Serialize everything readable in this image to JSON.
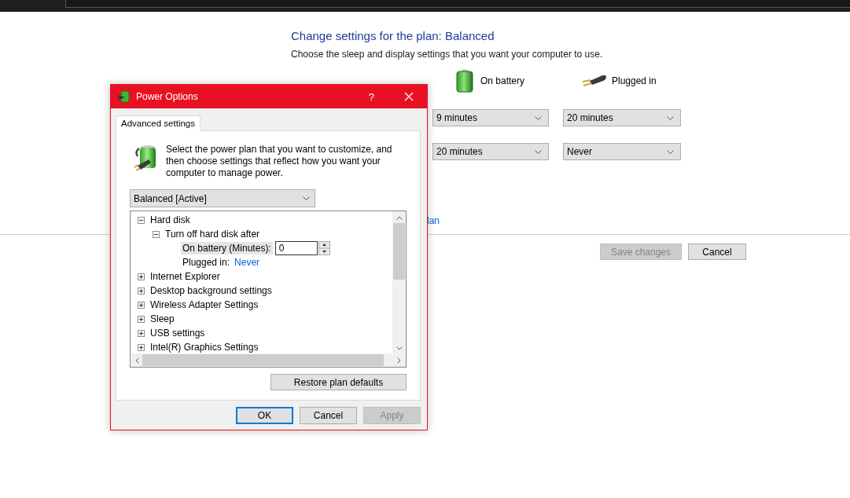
{
  "page": {
    "title": "Change settings for the plan: Balanced",
    "subtitle": "Choose the sleep and display settings that you want your computer to use.",
    "columns": [
      {
        "kind": "battery",
        "label": "On battery"
      },
      {
        "kind": "plug",
        "label": "Plugged in"
      }
    ],
    "rows": [
      {
        "values": [
          "9 minutes",
          "20 minutes"
        ]
      },
      {
        "values": [
          "20 minutes",
          "Never"
        ]
      }
    ],
    "partial_link": "lan",
    "buttons": [
      {
        "label": "Save changes",
        "disabled": true
      },
      {
        "label": "Cancel",
        "disabled": false
      }
    ]
  },
  "dialog": {
    "title": "Power Options",
    "help": "?",
    "tabs": [
      {
        "label": "Advanced settings",
        "selected": true
      }
    ],
    "description": "Select the power plan that you want to customize, and then choose settings that reflect how you want your computer to manage power.",
    "plan": "Balanced [Active]",
    "tree": [
      {
        "label": "Hard disk",
        "expanded": true,
        "children": [
          {
            "label": "Turn off hard disk after",
            "expanded": true,
            "children": [
              {
                "kind": "spin",
                "label": "On battery (Minutes):",
                "value": "0",
                "selected": true
              },
              {
                "kind": "link",
                "label": "Plugged in:",
                "value": "Never",
                "selected": false
              }
            ]
          }
        ]
      },
      {
        "label": "Internet Explorer",
        "expanded": false
      },
      {
        "label": "Desktop background settings",
        "expanded": false
      },
      {
        "label": "Wireless Adapter Settings",
        "expanded": false
      },
      {
        "label": "Sleep",
        "expanded": false
      },
      {
        "label": "USB settings",
        "expanded": false
      },
      {
        "label": "Intel(R) Graphics Settings",
        "expanded": false
      }
    ],
    "restore": "Restore plan defaults",
    "buttons": [
      {
        "label": "OK",
        "default": true,
        "disabled": false
      },
      {
        "label": "Cancel",
        "default": false,
        "disabled": false
      },
      {
        "label": "Apply",
        "default": false,
        "disabled": true
      }
    ]
  }
}
